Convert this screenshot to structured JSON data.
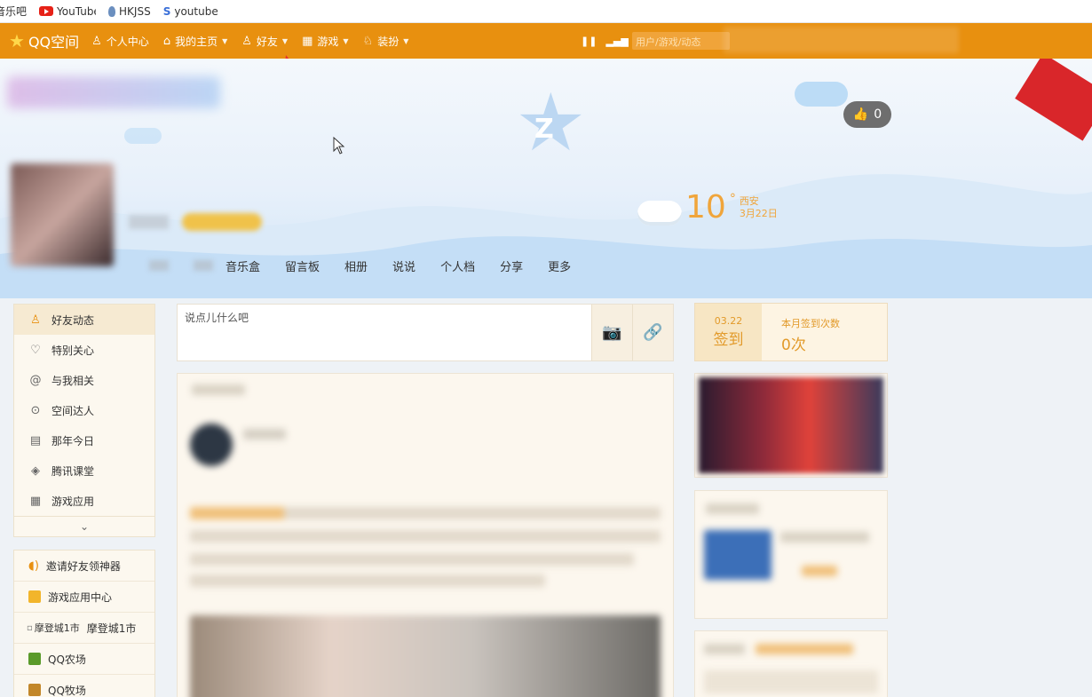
{
  "bookmarks": [
    {
      "label": "音乐吧",
      "icon": "text-icon"
    },
    {
      "label": "YouTube",
      "icon": "youtube-icon"
    },
    {
      "label": "HKJSS",
      "icon": "drop-icon"
    },
    {
      "label": "youtube",
      "icon": "bookmark-icon"
    }
  ],
  "nav": {
    "logo": "QQ空间",
    "items": [
      {
        "label": "个人中心",
        "icon": "user-icon",
        "caret": false
      },
      {
        "label": "我的主页",
        "icon": "home-icon",
        "caret": true
      },
      {
        "label": "好友",
        "icon": "friends-icon",
        "caret": true
      },
      {
        "label": "游戏",
        "icon": "grid-icon",
        "caret": true
      },
      {
        "label": "装扮",
        "icon": "shirt-icon",
        "caret": true
      }
    ],
    "search_placeholder": "用户/游戏/动态"
  },
  "banner": {
    "likes": "0",
    "weather": {
      "temp": "10",
      "deg": "°",
      "city": "西安",
      "date": "3月22日"
    },
    "tabs": [
      "音乐盒",
      "留言板",
      "相册",
      "说说",
      "个人档",
      "分享",
      "更多"
    ]
  },
  "left_menu": [
    {
      "label": "好友动态",
      "icon": "user-icon",
      "active": true
    },
    {
      "label": "特别关心",
      "icon": "heart-icon",
      "active": false
    },
    {
      "label": "与我相关",
      "icon": "at-icon",
      "active": false
    },
    {
      "label": "空间达人",
      "icon": "play-icon",
      "active": false
    },
    {
      "label": "那年今日",
      "icon": "calendar-icon",
      "active": false
    },
    {
      "label": "腾讯课堂",
      "icon": "class-icon",
      "active": false
    },
    {
      "label": "游戏应用",
      "icon": "apps-icon",
      "active": false
    }
  ],
  "left_apps": [
    {
      "label": "邀请好友领神器",
      "icon": "invite-icon",
      "color": "#e8900f"
    },
    {
      "label": "游戏应用中心",
      "icon": "game-center-icon",
      "color": "#f2b52b"
    },
    {
      "label": "摩登城1市",
      "prefix": "摩登城1市",
      "icon": "broken-image-icon",
      "color": "#cccccc"
    },
    {
      "label": "QQ农场",
      "icon": "farm-icon",
      "color": "#5a9a2a"
    },
    {
      "label": "QQ牧场",
      "icon": "ranch-icon",
      "color": "#c2872a"
    }
  ],
  "post": {
    "placeholder": "说点儿什么吧"
  },
  "sign": {
    "date": "03.22",
    "button": "签到",
    "label": "本月签到次数",
    "count": "0次"
  }
}
